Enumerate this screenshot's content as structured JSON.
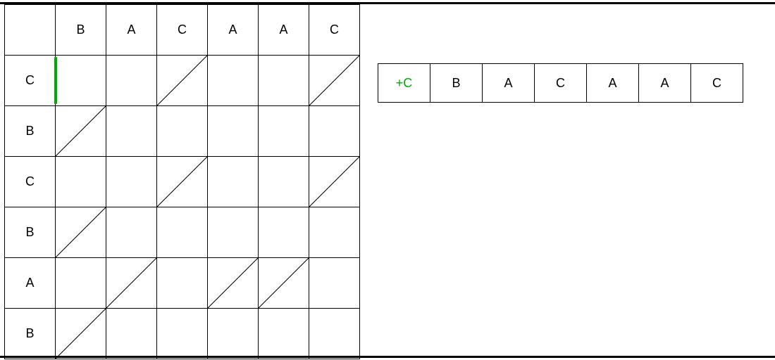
{
  "grid": {
    "top_headers": [
      "B",
      "A",
      "C",
      "A",
      "A",
      "C"
    ],
    "left_headers": [
      "C",
      "B",
      "C",
      "B",
      "A",
      "B"
    ],
    "diagonals": [
      [
        false,
        false,
        true,
        false,
        false,
        true
      ],
      [
        true,
        false,
        false,
        false,
        false,
        false
      ],
      [
        false,
        false,
        true,
        false,
        false,
        true
      ],
      [
        true,
        false,
        false,
        false,
        false,
        false
      ],
      [
        false,
        true,
        false,
        true,
        true,
        false
      ],
      [
        true,
        false,
        false,
        false,
        false,
        false
      ]
    ],
    "highlight": {
      "row": 0,
      "col": 0
    }
  },
  "strip": {
    "insert_label": "+C",
    "cells": [
      "B",
      "A",
      "C",
      "A",
      "A",
      "C"
    ]
  }
}
